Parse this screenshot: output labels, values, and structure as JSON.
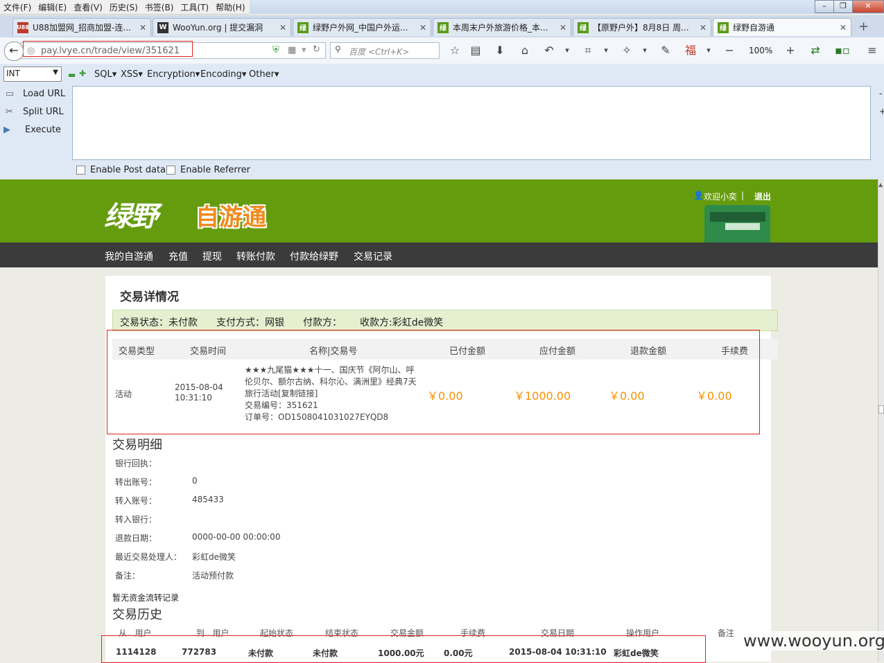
{
  "menu": [
    "文件(F)",
    "编辑(E)",
    "查看(V)",
    "历史(S)",
    "书签(B)",
    "工具(T)",
    "帮助(H)"
  ],
  "tabs": [
    {
      "title": "U88加盟网_招商加盟-连...",
      "favicon": "U88",
      "color": "#c0392b"
    },
    {
      "title": "WooYun.org | 提交漏洞",
      "favicon": "W",
      "color": "#333333"
    },
    {
      "title": "绿野户外网_中国户外运...",
      "favicon": "绿",
      "color": "#5a9a1a"
    },
    {
      "title": "本周末户外旅游价格_本...",
      "favicon": "绿",
      "color": "#5a9a1a"
    },
    {
      "title": "【原野户外】8月8日 周...",
      "favicon": "绿",
      "color": "#5a9a1a"
    },
    {
      "title": "绿野自游通",
      "favicon": "绿",
      "color": "#5a9a1a",
      "active": true
    }
  ],
  "url": "pay.lvye.cn/trade/view/351621",
  "search_placeholder": "百度 <Ctrl+K>",
  "zoom": "100%",
  "hackbar": {
    "select": "INT",
    "menus": [
      "SQL▾",
      "XSS▾",
      "Encryption▾",
      "Encoding▾",
      "Other▾"
    ],
    "actions": [
      "Load URL",
      "Split URL",
      "Execute"
    ],
    "checks": [
      "Enable Post data",
      "Enable Referrer"
    ]
  },
  "site": {
    "logo_a": "绿野",
    "logo_b": "自游通",
    "welcome": "欢迎小奕",
    "sep": "|",
    "logout": "退出",
    "nav": [
      "我的自游通",
      "充值",
      "提现",
      "转账付款",
      "付款给绿野",
      "交易记录"
    ]
  },
  "detail": {
    "title": "交易详情况",
    "status": "交易状态：未付款",
    "pay_method": "支付方式：网银",
    "payer": "付款方：",
    "payee": "收款方:彩虹de微笑",
    "headers": [
      "交易类型",
      "交易时间",
      "名称|交易号",
      "已付金额",
      "应付金额",
      "退款金额",
      "手续费"
    ],
    "row": {
      "type": "活动",
      "date": "2015-08-04",
      "time": "10:31:10",
      "name_lines": [
        "★★★九尾猫★★★十一、国庆节《阿尔山、呼",
        "伦贝尔、额尔古纳、科尔沁、满洲里》经典7天",
        "旅行活动[复制链接]",
        "交易编号：351621",
        "订单号：OD1508041031027EYQD8"
      ],
      "paid": "￥0.00",
      "due": "￥1000.00",
      "refund": "￥0.00",
      "fee": "￥0.00"
    }
  },
  "breakdown": {
    "title": "交易明细",
    "rows": [
      {
        "label": "银行回执：",
        "value": ""
      },
      {
        "label": "转出账号：",
        "value": "0"
      },
      {
        "label": "转入账号：",
        "value": "485433"
      },
      {
        "label": "转入银行：",
        "value": ""
      },
      {
        "label": "退款日期：",
        "value": "0000-00-00 00:00:00"
      },
      {
        "label": "最近交易处理人：",
        "value": "彩虹de微笑"
      },
      {
        "label": "备注：",
        "value": "活动预付款"
      }
    ],
    "no_flow": "暂无资金流转记录"
  },
  "history": {
    "title": "交易历史",
    "headers": [
      "从...用户",
      "到...用户",
      "起始状态",
      "结束状态",
      "交易金额",
      "手续费",
      "交易日期",
      "操作用户",
      "备注"
    ],
    "row": [
      "1114128",
      "772783",
      "未付款",
      "未付款",
      "1000.00元",
      "0.00元",
      "2015-08-04 10:31:10",
      "彩虹de微笑",
      ""
    ]
  },
  "watermark": "www.wooyun.org"
}
